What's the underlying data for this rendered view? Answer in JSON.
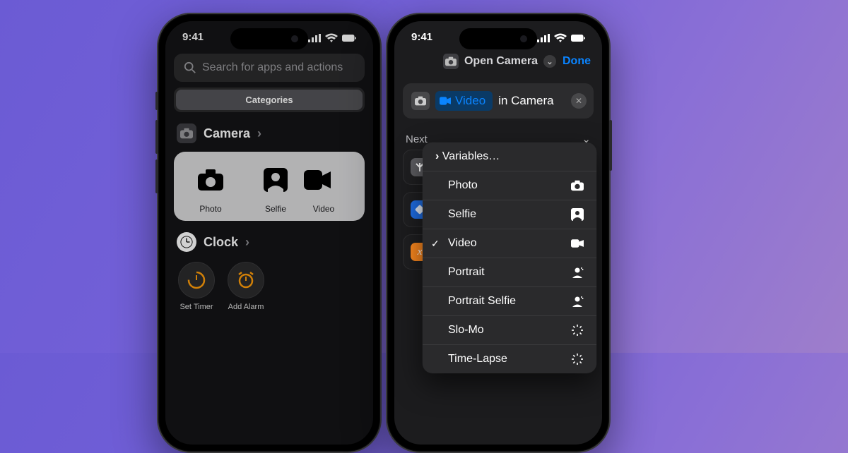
{
  "status": {
    "time": "9:41"
  },
  "phone_left": {
    "search_placeholder": "Search for apps and actions",
    "segment_categories": "Categories",
    "camera": {
      "title": "Camera",
      "items": [
        {
          "label": "Photo"
        },
        {
          "label": "Selfie"
        },
        {
          "label": "Video"
        }
      ]
    },
    "clock": {
      "title": "Clock",
      "items": [
        {
          "label": "Set Timer"
        },
        {
          "label": "Add Alarm"
        }
      ]
    }
  },
  "phone_right": {
    "header": {
      "title": "Open Camera",
      "done": "Done"
    },
    "action": {
      "selected_mode": "Video",
      "suffix": "in Camera"
    },
    "next_label": "Next",
    "suggestions": [
      {
        "icon": "split",
        "color": "#5e5e62"
      },
      {
        "icon": "shortcuts",
        "color": "#1f6fe8"
      },
      {
        "icon": "xscript",
        "color": "#ff8a1f"
      }
    ],
    "popover": {
      "variables": "Variables…",
      "options": [
        {
          "label": "Photo",
          "icon": "camera",
          "checked": false
        },
        {
          "label": "Selfie",
          "icon": "selfie",
          "checked": false
        },
        {
          "label": "Video",
          "icon": "video",
          "checked": true
        },
        {
          "label": "Portrait",
          "icon": "portrait",
          "checked": false
        },
        {
          "label": "Portrait Selfie",
          "icon": "portrait",
          "checked": false
        },
        {
          "label": "Slo-Mo",
          "icon": "spinner",
          "checked": false
        },
        {
          "label": "Time-Lapse",
          "icon": "spinner",
          "checked": false
        }
      ]
    }
  }
}
